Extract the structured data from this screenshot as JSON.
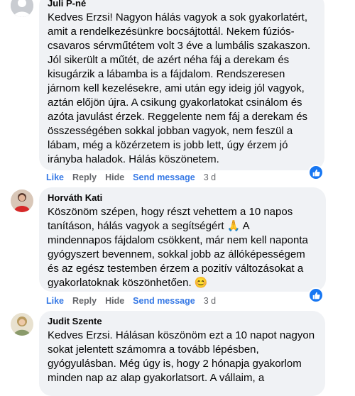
{
  "comments": [
    {
      "name": "Juli P-né",
      "lines": [
        "Kedves Erzsi! Nagyon hálás vagyok a sok gyakorlatért,",
        "amit a rendelkezésünkre bocsájtottál. Nekem fúziós-",
        "csavaros sérvműtétem volt 3 éve a lumbális szakaszon.",
        "Jól sikerült a műtét, de azért néha fáj a derekam és",
        "kisugárzik a lábamba is a fájdalom. Rendszeresen",
        "járnom kell kezelésekre, ami után egy ideig jól vagyok,",
        "aztán előjön újra. A csikung gyakorlatokat csinálom és",
        "azóta javulást érzek. Reggelente nem fáj a derekam és",
        "összességében sokkal jobban vagyok, nem feszül a",
        "lábam, még a közérzetem is jobb lett, úgy érzem jó",
        "irányba haladok. Hálás köszönetem."
      ],
      "actions": {
        "like": "Like",
        "reply": "Reply",
        "hide": "Hide",
        "send": "Send message",
        "time": "3 d"
      }
    },
    {
      "name": "Horváth Kati",
      "lines": [
        "Köszönöm szépen, hogy részt vehettem a 10 napos",
        "tanításon, hálás vagyok a segítségért 🙏 A",
        "mindennapos fájdalom csökkent, már nem kell naponta",
        "gyógyszert bevennem, sokkal jobb az állóképességem",
        "és az egész testemben érzem a pozitív változásokat a",
        "gyakorlatoknak köszönhetően. 😊"
      ],
      "actions": {
        "like": "Like",
        "reply": "Reply",
        "hide": "Hide",
        "send": "Send message",
        "time": "3 d"
      }
    },
    {
      "name": "Judit Szente",
      "lines": [
        "Kedves Erzsi. Hálásan köszönöm ezt a 10 napot nagyon",
        "sokat jelentett számomra a tovább lépésben,",
        "gyógyulásban. Még úgy is, hogy 2 hónapja gyakorlom",
        "minden nap az alap gyakorlatsort. A vállaim, a"
      ]
    }
  ],
  "colors": {
    "link": "#3578e5",
    "bubble": "#f0f2f5",
    "reaction": "#1877f2"
  },
  "reaction_icon": "thumbs-up-icon"
}
